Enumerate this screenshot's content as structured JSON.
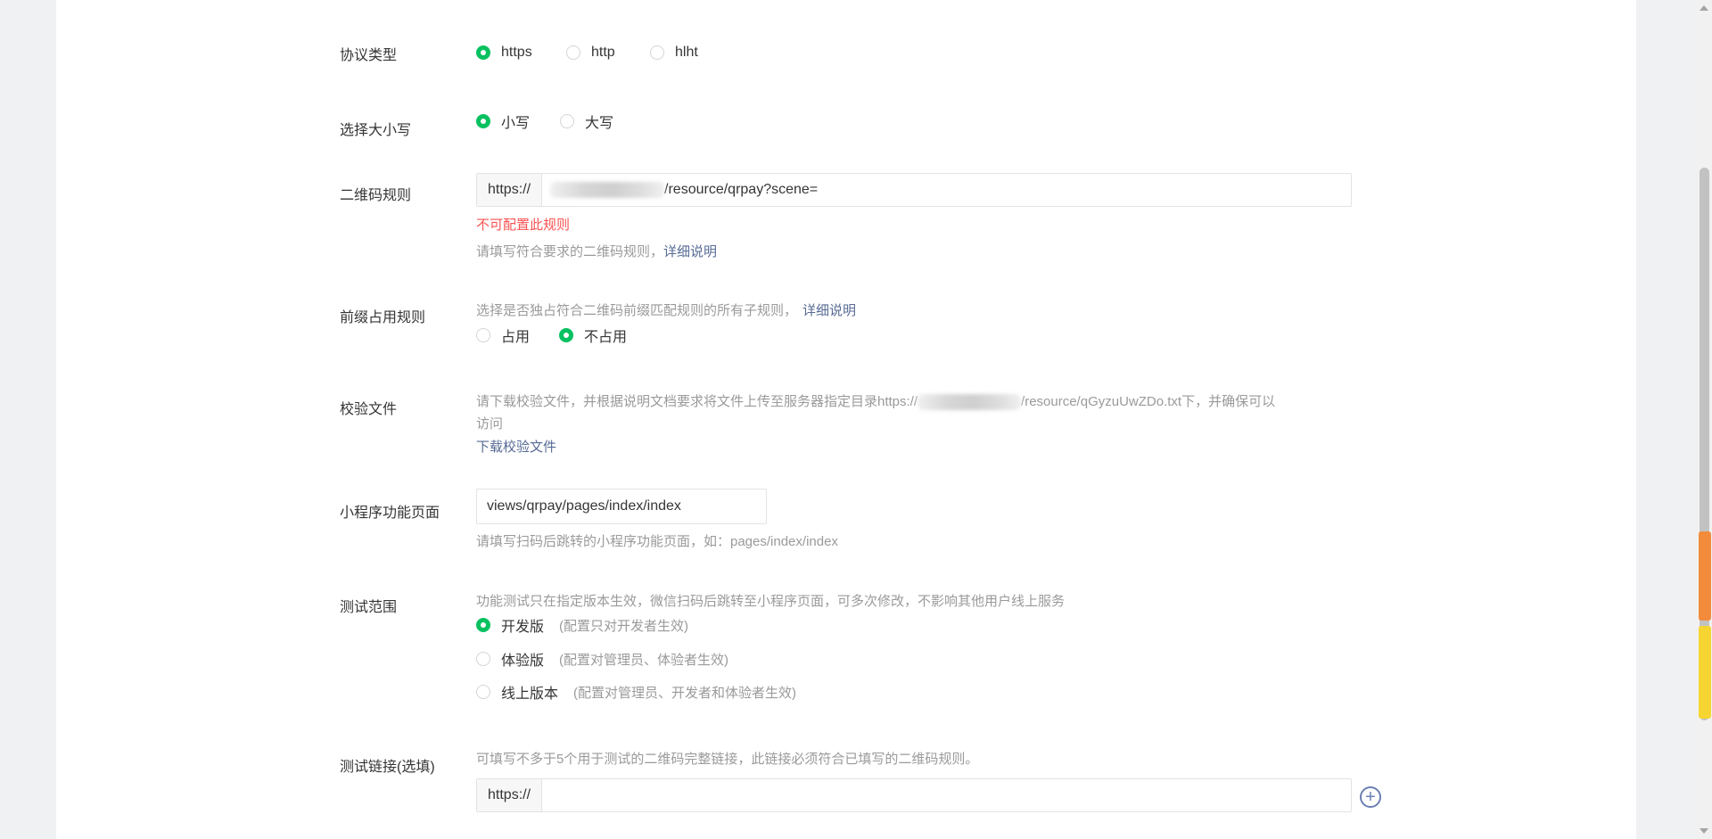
{
  "protocol": {
    "label": "协议类型",
    "options": [
      {
        "label": "https",
        "checked": true
      },
      {
        "label": "http",
        "checked": false
      },
      {
        "label": "hlht",
        "checked": false
      }
    ]
  },
  "case": {
    "label": "选择大小写",
    "options": [
      {
        "label": "小写",
        "checked": true
      },
      {
        "label": "大写",
        "checked": false
      }
    ]
  },
  "qr_rule": {
    "label": "二维码规则",
    "prefix": "https://",
    "value_suffix": "/resource/qrpay?scene=",
    "error": "不可配置此规则",
    "help": "请填写符合要求的二维码规则，",
    "help_link": "详细说明"
  },
  "prefix_rule": {
    "label": "前缀占用规则",
    "help": "选择是否独占符合二维码前缀匹配规则的所有子规则，",
    "help_link": "详细说明",
    "options": [
      {
        "label": "占用",
        "checked": false
      },
      {
        "label": "不占用",
        "checked": true
      }
    ]
  },
  "verify_file": {
    "label": "校验文件",
    "help_line1_start": "请下载校验文件，并根据说明文档要求将文件上传至服务器指定目录https://",
    "help_line1_end": "/resource/qGyzuUwZDo.txt下，并确保可以",
    "help_line2": "访问",
    "download_link": "下载校验文件"
  },
  "mini_page": {
    "label": "小程序功能页面",
    "value": "views/qrpay/pages/index/index",
    "help": "请填写扫码后跳转的小程序功能页面，如：pages/index/index"
  },
  "test_scope": {
    "label": "测试范围",
    "help": "功能测试只在指定版本生效，微信扫码后跳转至小程序页面，可多次修改，不影响其他用户线上服务",
    "options": [
      {
        "label": "开发版",
        "hint": "(配置只对开发者生效)",
        "checked": true
      },
      {
        "label": "体验版",
        "hint": "(配置对管理员、体验者生效)",
        "checked": false
      },
      {
        "label": "线上版本",
        "hint": "(配置对管理员、开发者和体验者生效)",
        "checked": false
      }
    ]
  },
  "test_links": {
    "label": "测试链接(选填)",
    "help": "可填写不多于5个用于测试的二维码完整链接，此链接必须符合已填写的二维码规则。",
    "prefix": "https://",
    "value": "",
    "add_icon": "plus-circle-icon"
  },
  "colors": {
    "accent_green": "#07c160",
    "link_blue": "#576b95",
    "error_red": "#fa5151"
  }
}
